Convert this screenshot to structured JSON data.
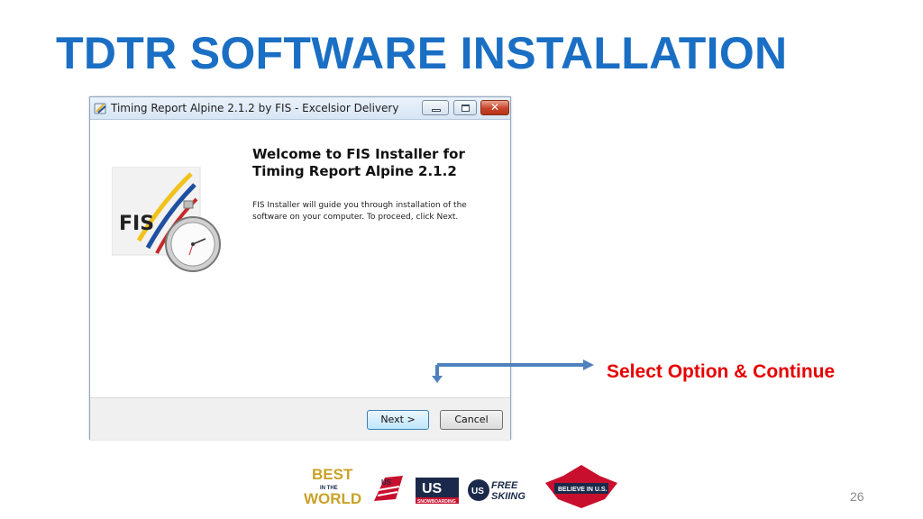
{
  "slide": {
    "title": "TDTR SOFTWARE INSTALLATION",
    "page_number": "26",
    "annotation": "Select Option & Continue",
    "annotation_color": "#e60000",
    "title_color": "#1a6fc4"
  },
  "window": {
    "title": "Timing Report Alpine 2.1.2 by FIS - Excelsior Delivery",
    "close_glyph": "✕",
    "logo_text": "FIS",
    "welcome_line1": "Welcome to FIS Installer for",
    "welcome_line2": "Timing Report Alpine 2.1.2",
    "description_line1": "FIS Installer will guide you through installation of the",
    "description_line2": "software on your computer. To proceed, click Next.",
    "next_label": "Next >",
    "cancel_label": "Cancel"
  },
  "footer_logos": {
    "best_line1": "BEST",
    "best_line2": "IN THE",
    "best_line3": "WORLD",
    "us_ski_team": "US SKI TEAM",
    "snowboarding": "SNOWBOARDING",
    "freeskiing_1": "FREE",
    "freeskiing_2": "SKIING",
    "believe": "BELIEVE IN U.S."
  }
}
